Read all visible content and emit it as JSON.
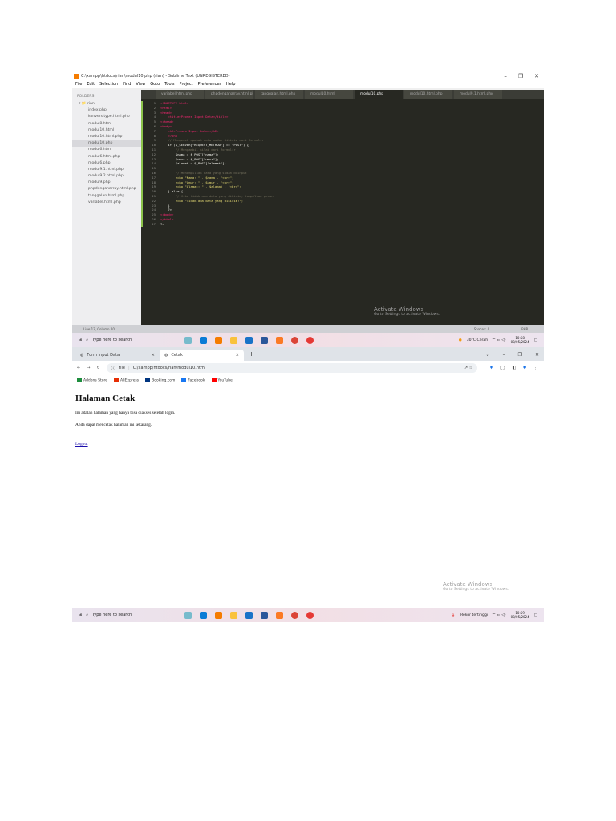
{
  "sublime": {
    "title": "C:\\xampp\\htdocs\\rian\\modul10.php (rian) - Sublime Text (UNREGISTERED)",
    "window_controls": [
      "–",
      "❐",
      "✕"
    ],
    "menu": [
      "File",
      "Edit",
      "Selection",
      "Find",
      "View",
      "Goto",
      "Tools",
      "Project",
      "Preferences",
      "Help"
    ],
    "sidebar": {
      "header": "FOLDERS",
      "root": "rian",
      "files": [
        "index.php",
        "konversitype.html.php",
        "modul8.html",
        "modul10.html",
        "modul10.html.php",
        "modul10.php",
        "modul6.html",
        "modul6.html.php",
        "modul6.php",
        "modul9.1.html.php",
        "modul9.2.html.php",
        "modul9.php",
        "phpdenganarray.html.php",
        "tanggalan.html.php",
        "variabel.html.php"
      ],
      "selected": "modul10.php"
    },
    "tabs": [
      "variabel.html.php",
      "phpdenganarray.html.php",
      "tanggalan.html.php",
      "modul10.html",
      "modul10.php",
      "modul10.html.php",
      "modul9.1.html.php"
    ],
    "active_tab": "modul10.php",
    "code": [
      "<!DOCTYPE html>",
      "<html>",
      "<head>",
      "    <title>Proses Input Data</title>",
      "</head>",
      "<body>",
      "    <h2>Proses Input Data:</h2>",
      "    <?php",
      "    // Mengecek apakah data sudah dikirim dari formulir",
      "    if ($_SERVER[\"REQUEST_METHOD\"] == \"POST\") {",
      "        // Mengambil nilai dari formulir",
      "        $nama = $_POST[\"nama\"];",
      "        $umur = $_POST[\"umur\"];",
      "        $alamat = $_POST[\"alamat\"];",
      "",
      "        // Menampilkan data yang sudah diinput",
      "        echo \"Nama: \" . $nama . \"<br>\";",
      "        echo \"Umur: \" . $umur . \"<br>\";",
      "        echo \"Alamat: \" . $alamat . \"<br>\";",
      "    } else {",
      "        // Jika tidak ada data yang dikirim, tampilkan pesan",
      "        echo \"Tidak ada data yang dikirim!\";",
      "    }",
      "    ?>",
      "</body>",
      "</html>",
      "?>"
    ],
    "status_left": "Line 13, Column 20",
    "status_right": [
      "Spaces: 4",
      "PHP"
    ],
    "watermark": {
      "title": "Activate Windows",
      "sub": "Go to Settings to activate Windows."
    }
  },
  "taskbar1": {
    "search": "Type here to search",
    "weather": "30°C  Cerah",
    "time": "10:58",
    "date": "08/05/2024"
  },
  "browser": {
    "tabs": [
      {
        "label": "Form Input Data"
      },
      {
        "label": "Cetak"
      }
    ],
    "new_tab": "+",
    "window_controls": [
      "⌄",
      "–",
      "❐",
      "✕"
    ],
    "address_prefix": "File",
    "url": "C:/xampp/htdocs/rian/modul10.html",
    "bookmarks": [
      {
        "label": "Addons Store",
        "color": "#1e8e3e"
      },
      {
        "label": "AliExpress",
        "color": "#e62e04"
      },
      {
        "label": "Booking.com",
        "color": "#003580"
      },
      {
        "label": "Facebook",
        "color": "#1877f2"
      },
      {
        "label": "YouTube",
        "color": "#ff0000"
      }
    ],
    "page": {
      "heading": "Halaman Cetak",
      "p1": "Ini adalah halaman yang hanya bisa diakses setelah login.",
      "p2": "Anda dapat mencetak halaman ini sekarang.",
      "link": "Logout"
    },
    "watermark": {
      "title": "Activate Windows",
      "sub": "Go to Settings to activate Windows."
    }
  },
  "taskbar2": {
    "search": "Type here to search",
    "weather": "Rekor tertinggi",
    "time": "10:59",
    "date": "08/05/2024"
  }
}
